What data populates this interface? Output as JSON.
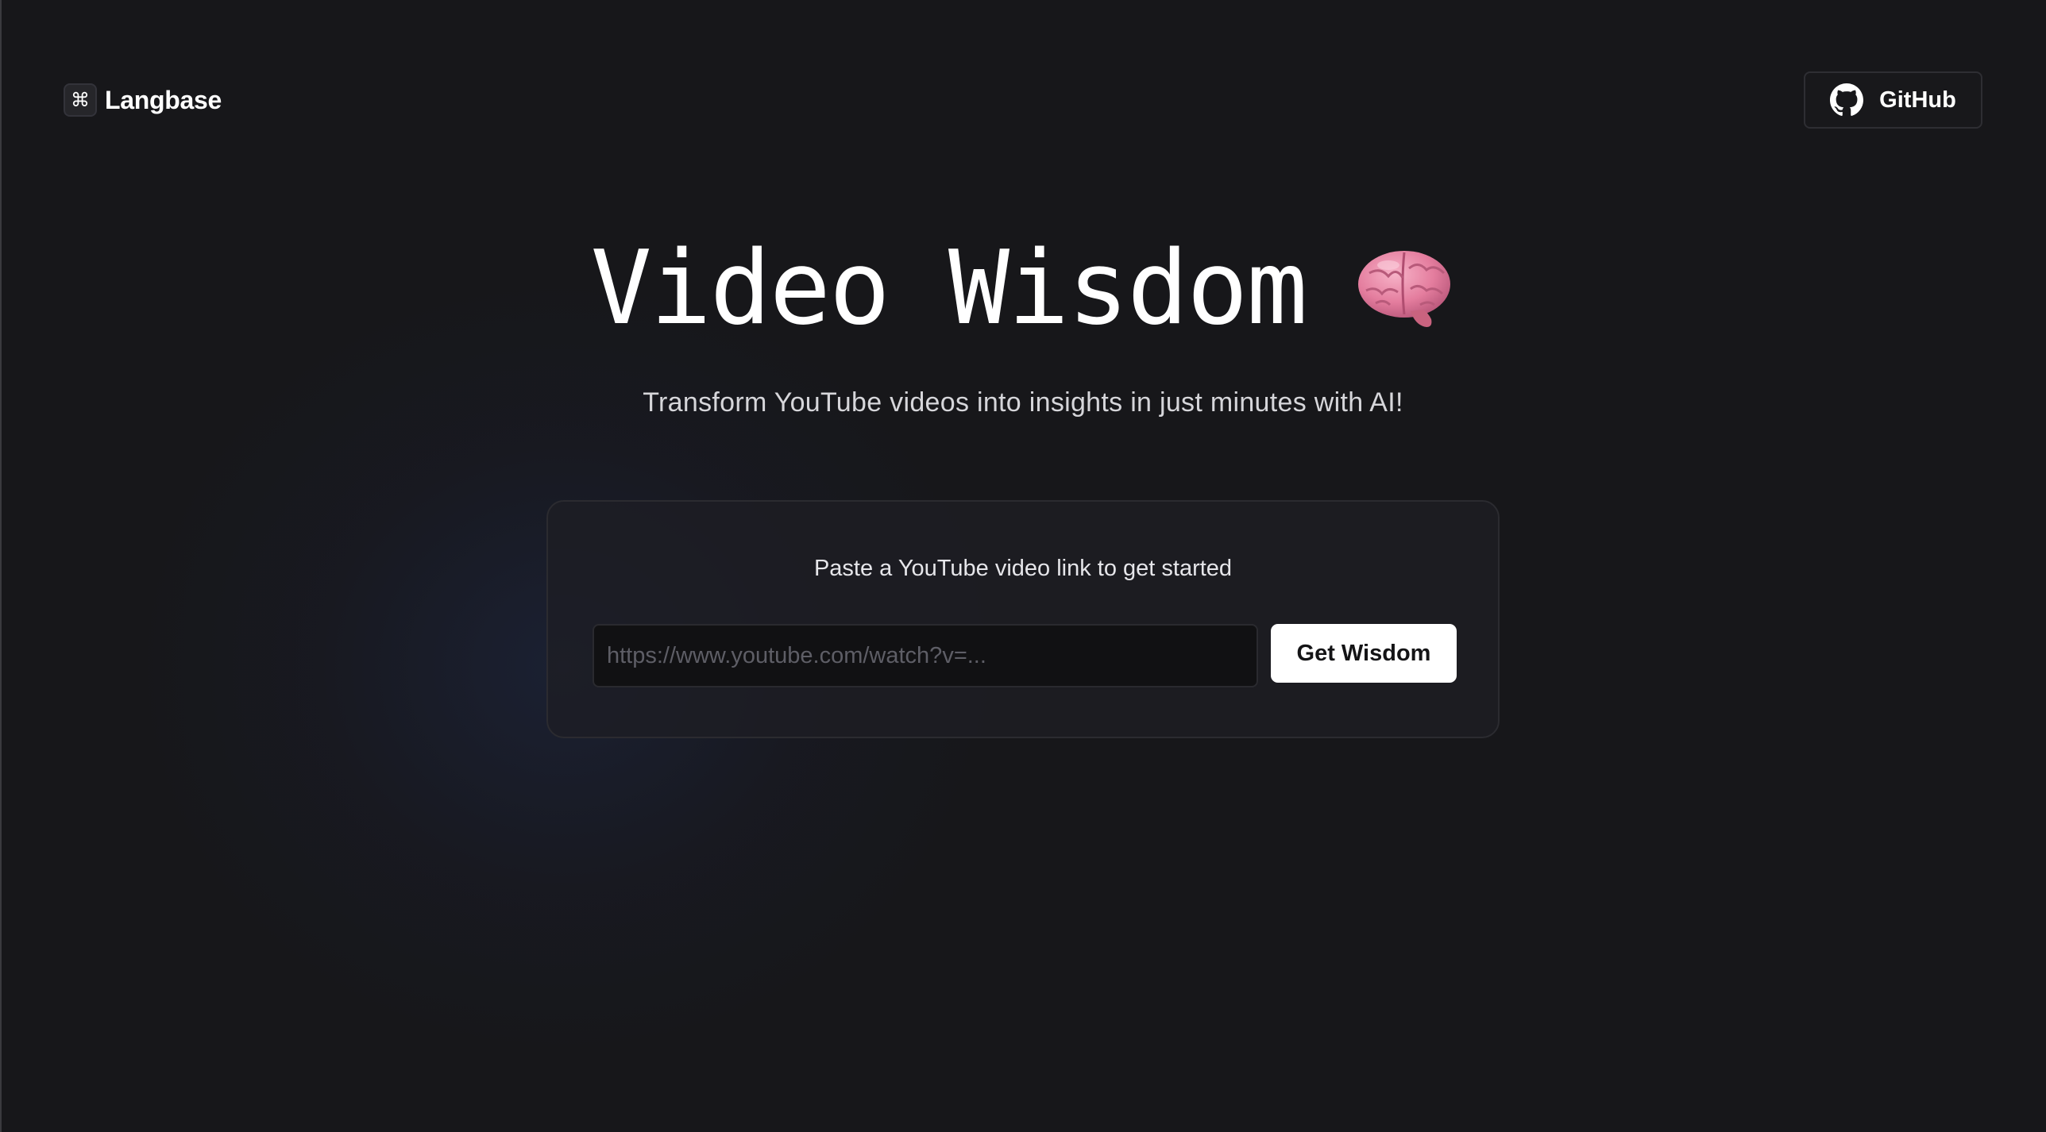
{
  "header": {
    "brand_icon_glyph": "⌘",
    "brand_name": "Langbase",
    "github_label": "GitHub"
  },
  "hero": {
    "title": "Video Wisdom",
    "title_icon": "brain-emoji",
    "subtitle": "Transform YouTube videos into insights in just minutes with AI!"
  },
  "card": {
    "prompt": "Paste a YouTube video link to get started",
    "input_value": "",
    "input_placeholder": "https://www.youtube.com/watch?v=...",
    "submit_label": "Get Wisdom"
  },
  "theme": {
    "background": "#17171a",
    "card_background": "#1e1e24",
    "button_background": "#ffffff",
    "text_primary": "#ffffff"
  }
}
